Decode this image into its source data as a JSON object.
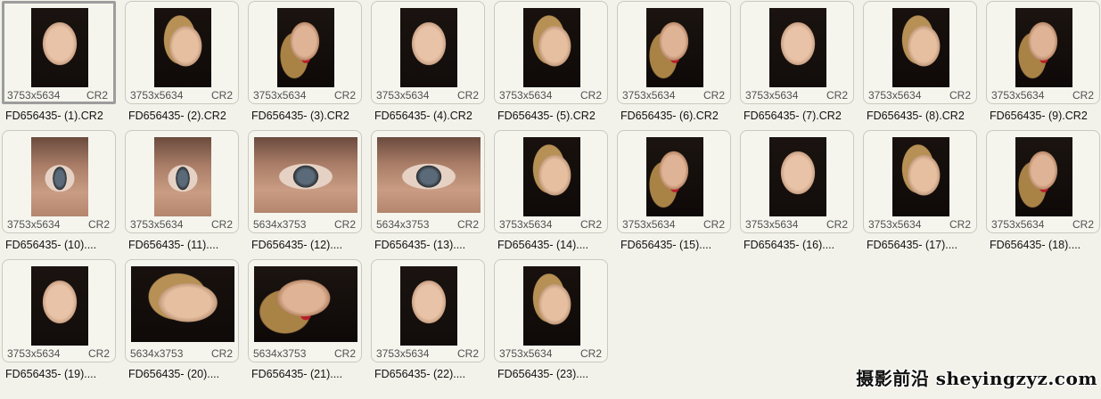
{
  "files": [
    {
      "name": "FD656435- (1).CR2",
      "dims": "3753x5634",
      "ext": "CR2",
      "orientation": "portrait",
      "selected": true
    },
    {
      "name": "FD656435- (2).CR2",
      "dims": "3753x5634",
      "ext": "CR2",
      "orientation": "portrait"
    },
    {
      "name": "FD656435- (3).CR2",
      "dims": "3753x5634",
      "ext": "CR2",
      "orientation": "portrait"
    },
    {
      "name": "FD656435- (4).CR2",
      "dims": "3753x5634",
      "ext": "CR2",
      "orientation": "portrait"
    },
    {
      "name": "FD656435- (5).CR2",
      "dims": "3753x5634",
      "ext": "CR2",
      "orientation": "portrait"
    },
    {
      "name": "FD656435- (6).CR2",
      "dims": "3753x5634",
      "ext": "CR2",
      "orientation": "portrait"
    },
    {
      "name": "FD656435- (7).CR2",
      "dims": "3753x5634",
      "ext": "CR2",
      "orientation": "portrait"
    },
    {
      "name": "FD656435- (8).CR2",
      "dims": "3753x5634",
      "ext": "CR2",
      "orientation": "portrait"
    },
    {
      "name": "FD656435- (9).CR2",
      "dims": "3753x5634",
      "ext": "CR2",
      "orientation": "portrait"
    },
    {
      "name": "FD656435- (10)....",
      "dims": "3753x5634",
      "ext": "CR2",
      "orientation": "portrait"
    },
    {
      "name": "FD656435- (11)....",
      "dims": "3753x5634",
      "ext": "CR2",
      "orientation": "portrait"
    },
    {
      "name": "FD656435- (12)....",
      "dims": "5634x3753",
      "ext": "CR2",
      "orientation": "landscape"
    },
    {
      "name": "FD656435- (13)....",
      "dims": "5634x3753",
      "ext": "CR2",
      "orientation": "landscape"
    },
    {
      "name": "FD656435- (14)....",
      "dims": "3753x5634",
      "ext": "CR2",
      "orientation": "portrait"
    },
    {
      "name": "FD656435- (15)....",
      "dims": "3753x5634",
      "ext": "CR2",
      "orientation": "portrait"
    },
    {
      "name": "FD656435- (16)....",
      "dims": "3753x5634",
      "ext": "CR2",
      "orientation": "portrait"
    },
    {
      "name": "FD656435- (17)....",
      "dims": "3753x5634",
      "ext": "CR2",
      "orientation": "portrait"
    },
    {
      "name": "FD656435- (18)....",
      "dims": "3753x5634",
      "ext": "CR2",
      "orientation": "portrait"
    },
    {
      "name": "FD656435- (19)....",
      "dims": "3753x5634",
      "ext": "CR2",
      "orientation": "portrait"
    },
    {
      "name": "FD656435- (20)....",
      "dims": "5634x3753",
      "ext": "CR2",
      "orientation": "landscape"
    },
    {
      "name": "FD656435- (21)....",
      "dims": "5634x3753",
      "ext": "CR2",
      "orientation": "landscape"
    },
    {
      "name": "FD656435- (22)....",
      "dims": "3753x5634",
      "ext": "CR2",
      "orientation": "portrait"
    },
    {
      "name": "FD656435- (23)....",
      "dims": "3753x5634",
      "ext": "CR2",
      "orientation": "portrait"
    }
  ],
  "watermark": "摄影前沿 sheyingzyz.com"
}
